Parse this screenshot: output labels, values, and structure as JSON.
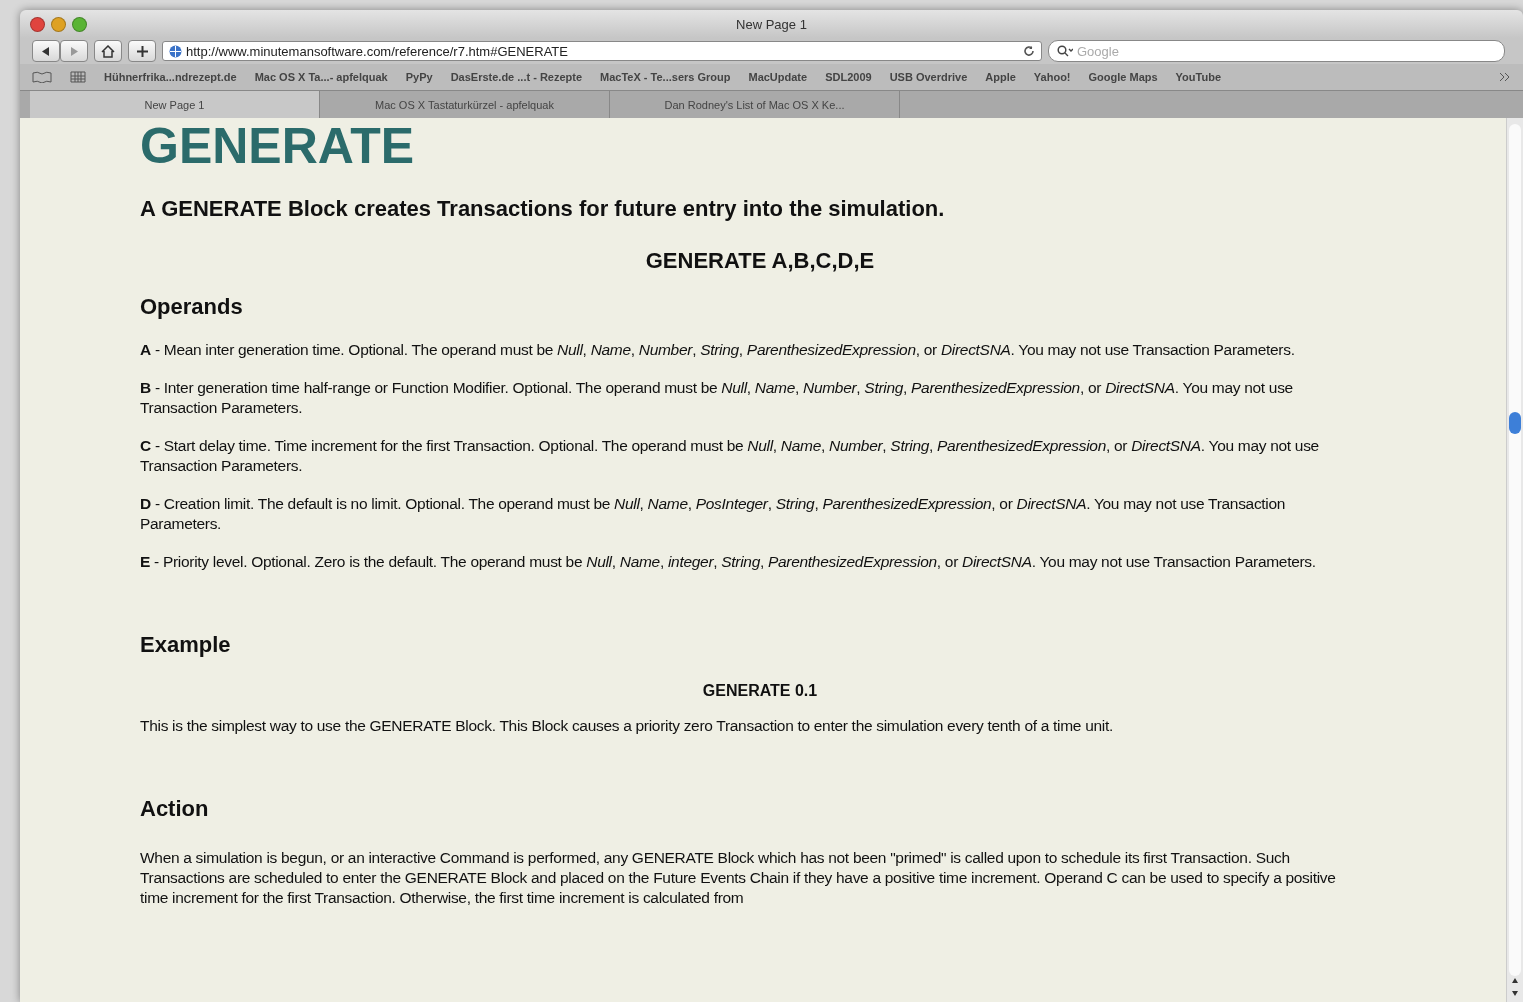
{
  "window": {
    "title": "New Page 1"
  },
  "toolbar": {
    "url": "http://www.minutemansoftware.com/reference/r7.htm#GENERATE",
    "search_placeholder": "Google"
  },
  "bookmarks": [
    "Hühnerfrika...ndrezept.de",
    "Mac OS X Ta...- apfelquak",
    "PyPy",
    "DasErste.de ...t - Rezepte",
    "MacTeX - Te...sers Group",
    "MacUpdate",
    "SDL2009",
    "USB Overdrive",
    "Apple",
    "Yahoo!",
    "Google Maps",
    "YouTube"
  ],
  "tabs": [
    {
      "label": "New Page 1",
      "selected": true
    },
    {
      "label": "Mac OS X Tastaturkürzel - apfelquak",
      "selected": false
    },
    {
      "label": "Dan Rodney's List of Mac OS X Ke...",
      "selected": false
    }
  ],
  "page": {
    "title": "GENERATE",
    "intro": "A GENERATE Block creates Transactions for future entry into the simulation.",
    "syntax": "GENERATE A,B,C,D,E",
    "sections": [
      {
        "heading": "Operands",
        "kind": "operands",
        "paragraphs": [
          "**A** - Mean inter generation time. Optional. The operand must be *Null*, *Name*, *Number*, *String*, *ParenthesizedExpression*, or *DirectSNA*. You may not use Transaction Parameters.",
          "**B** - Inter generation time half-range or Function Modifier. Optional. The operand must be *Null*, *Name*, *Number*, *String*, *ParenthesizedExpression*, or *DirectSNA*. You may not use Transaction Parameters.",
          "**C** - Start delay time. Time increment for the first Transaction. Optional. The operand must be *Null*, *Name*, *Number*, *String*, *ParenthesizedExpression*, or *DirectSNA*. You may not use Transaction Parameters.",
          "**D** - Creation limit. The default is no limit. Optional. The operand must be *Null*, *Name*, *PosInteger*, *String*, *ParenthesizedExpression*, or *DirectSNA*. You may not use Transaction Parameters.",
          "**E** - Priority level. Optional. Zero is the default. The operand must be *Null*, *Name*, *integer*, *String*, *ParenthesizedExpression*, or *DirectSNA*. You may not use Transaction Parameters."
        ]
      },
      {
        "heading": "Example",
        "kind": "example",
        "code": "GENERATE 0.1",
        "paragraphs": [
          "This is the simplest way to use the GENERATE Block. This Block causes a priority zero Transaction to enter the simulation every tenth of a time unit."
        ]
      },
      {
        "heading": "Action",
        "kind": "text",
        "paragraphs": [
          "When a simulation is begun, or an interactive Command is performed, any GENERATE Block which has not been \"primed\" is called upon to schedule its first Transaction. Such Transactions are scheduled to enter the GENERATE Block and placed on the Future Events Chain if they have a positive time increment. Operand C can be used to specify a positive time increment for the first Transaction. Otherwise, the first time increment is calculated from"
        ]
      }
    ]
  }
}
